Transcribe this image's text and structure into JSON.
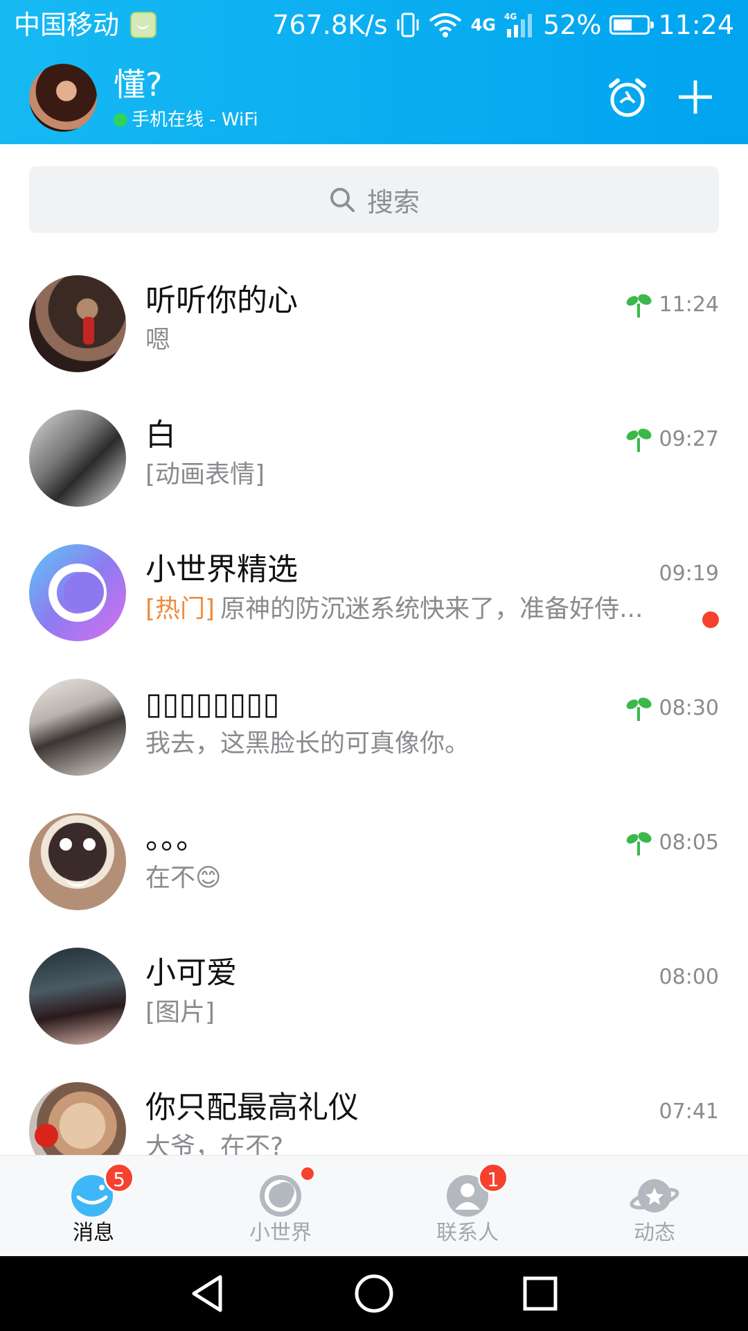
{
  "status_bar": {
    "carrier": "中国移动",
    "speed": "767.8K/s",
    "network": "4G",
    "battery": "52%",
    "time": "11:24"
  },
  "header": {
    "nickname": "懂?",
    "status": "手机在线 - WiFi"
  },
  "search": {
    "placeholder": "搜索"
  },
  "chats": [
    {
      "name": "听听你的心",
      "preview": "嗯",
      "tag": "",
      "time": "11:24",
      "sprout": true,
      "unread_dot": false
    },
    {
      "name": "白",
      "preview": "[动画表情]",
      "tag": "",
      "time": "09:27",
      "sprout": true,
      "unread_dot": false
    },
    {
      "name": "小世界精选",
      "preview": "原神的防沉迷系统快来了，准备好侍...",
      "tag": "[热门]",
      "time": "09:19",
      "sprout": false,
      "unread_dot": true
    },
    {
      "name": "▯▯▯▯▯▯▯▯",
      "preview": "我去，这黑脸长的可真像你。",
      "tag": "",
      "time": "08:30",
      "sprout": true,
      "unread_dot": false
    },
    {
      "name": "。。。",
      "preview": "在不😊",
      "tag": "",
      "time": "08:05",
      "sprout": true,
      "unread_dot": false
    },
    {
      "name": "小可爱",
      "preview": "[图片]",
      "tag": "",
      "time": "08:00",
      "sprout": false,
      "unread_dot": false
    },
    {
      "name": "你只配最高礼仪",
      "preview": "大爷，在不?",
      "tag": "",
      "time": "07:41",
      "sprout": false,
      "unread_dot": false
    }
  ],
  "bottom_nav": {
    "items": [
      {
        "label": "消息",
        "badge": "5"
      },
      {
        "label": "小世界",
        "badge": ""
      },
      {
        "label": "联系人",
        "badge": "1"
      },
      {
        "label": "动态",
        "badge": ""
      }
    ]
  },
  "colors": {
    "header_gradient_start": "#16b9f2",
    "header_gradient_end": "#00a4ef",
    "badge_red": "#f5412d",
    "tag_orange": "#f08a3c",
    "sprout_green": "#3cb84a"
  }
}
